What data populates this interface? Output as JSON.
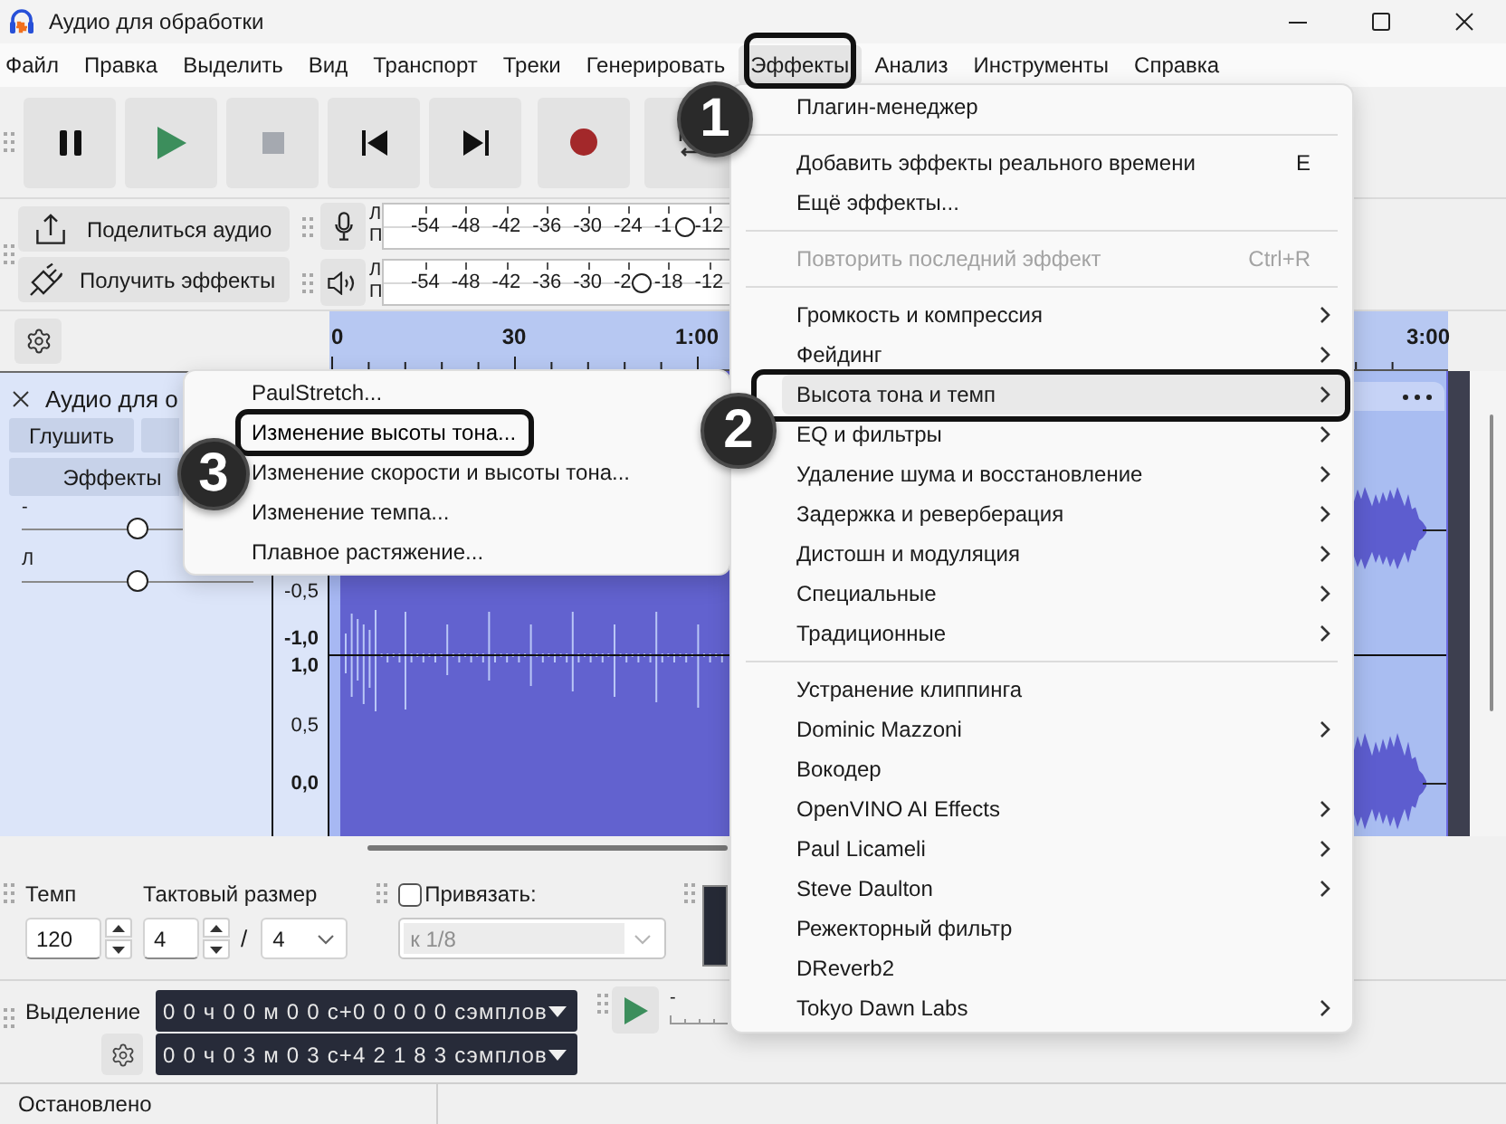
{
  "window": {
    "title": "Аудио для обработки"
  },
  "menu_bar": [
    {
      "label": "Файл",
      "selected": false
    },
    {
      "label": "Правка",
      "selected": false
    },
    {
      "label": "Выделить",
      "selected": false
    },
    {
      "label": "Вид",
      "selected": false
    },
    {
      "label": "Транспорт",
      "selected": false
    },
    {
      "label": "Треки",
      "selected": false
    },
    {
      "label": "Генерировать",
      "selected": false
    },
    {
      "label": "Эффекты",
      "selected": true
    },
    {
      "label": "Анализ",
      "selected": false
    },
    {
      "label": "Инструменты",
      "selected": false
    },
    {
      "label": "Справка",
      "selected": false
    }
  ],
  "share_buttons": [
    "Поделиться аудио",
    "Получить эффекты"
  ],
  "meters": [
    {
      "kind": "recording",
      "channels": [
        "Л",
        "П"
      ],
      "ticks": [
        "-54",
        "-48",
        "-42",
        "-36",
        "-30",
        "-24",
        "-1",
        "-12"
      ],
      "level": 0.84
    },
    {
      "kind": "playback",
      "channels": [
        "Л",
        "П"
      ],
      "ticks": [
        "-54",
        "-48",
        "-42",
        "-36",
        "-30",
        "-2",
        "-18",
        "-12"
      ],
      "level": 0.72
    }
  ],
  "ruler": {
    "labels": [
      "0",
      "30",
      "1:00",
      "3:00"
    ]
  },
  "track": {
    "name": "Аудио для о",
    "mute_button": "Глушить",
    "effects_button": "Эффекты",
    "sliders": [
      {
        "label": "-",
        "level": 0.5
      },
      {
        "label": "Л",
        "level": 0.5
      }
    ],
    "scale": [
      {
        "label": "-0,5",
        "kind": "minor"
      },
      {
        "label": "-1,0",
        "kind": "major"
      },
      {
        "label": "1,0",
        "kind": "major"
      },
      {
        "label": "0,5",
        "kind": "minor"
      },
      {
        "label": "0,0",
        "kind": "major"
      }
    ]
  },
  "time_toolbar": {
    "tempo": {
      "label": "Темп",
      "value": "120"
    },
    "time_signature": {
      "label": "Тактовый размер",
      "upper": "4",
      "separator": "/",
      "lower": "4"
    },
    "snap": {
      "label": "Привязать:",
      "checked": false,
      "value": "к 1/8",
      "disabled": true
    }
  },
  "selection_toolbar": {
    "label": "Выделение",
    "start": "0 0 ч 0 0 м 0 0 с+0 0 0 0 0 сэмплов",
    "end": "0 0 ч 0 3 м 0 3 с+4 2 1 8 3 сэмплов",
    "speed_label": "-"
  },
  "status_bar": {
    "text": "Остановлено"
  },
  "effects_menu": {
    "groups": [
      [
        {
          "label": "Плагин-менеджер",
          "submenu": false,
          "disabled": false,
          "selected": false
        }
      ],
      [
        {
          "label": "Добавить эффекты реального времени",
          "shortcut": "E",
          "submenu": false,
          "disabled": false,
          "selected": false
        },
        {
          "label": "Ещё эффекты...",
          "submenu": false,
          "disabled": false,
          "selected": false
        }
      ],
      [
        {
          "label": "Повторить последний эффект",
          "shortcut": "Ctrl+R",
          "submenu": false,
          "disabled": true,
          "selected": false
        }
      ],
      [
        {
          "label": "Громкость и компрессия",
          "submenu": true,
          "disabled": false,
          "selected": false
        },
        {
          "label": "Фейдинг",
          "submenu": true,
          "disabled": false,
          "selected": false
        },
        {
          "label": "Высота тона и темп",
          "submenu": true,
          "disabled": false,
          "selected": true
        },
        {
          "label": "EQ и фильтры",
          "submenu": true,
          "disabled": false,
          "selected": false
        },
        {
          "label": "Удаление шума и восстановление",
          "submenu": true,
          "disabled": false,
          "selected": false
        },
        {
          "label": "Задержка и реверберация",
          "submenu": true,
          "disabled": false,
          "selected": false
        },
        {
          "label": "Дистошн и модуляция",
          "submenu": true,
          "disabled": false,
          "selected": false
        },
        {
          "label": "Специальные",
          "submenu": true,
          "disabled": false,
          "selected": false
        },
        {
          "label": "Традиционные",
          "submenu": true,
          "disabled": false,
          "selected": false
        }
      ],
      [
        {
          "label": "Устранение клиппинга",
          "submenu": false,
          "disabled": false,
          "selected": false
        },
        {
          "label": "Dominic Mazzoni",
          "submenu": true,
          "disabled": false,
          "selected": false
        },
        {
          "label": "Вокодер",
          "submenu": false,
          "disabled": false,
          "selected": false
        },
        {
          "label": "OpenVINO AI Effects",
          "submenu": true,
          "disabled": false,
          "selected": false
        },
        {
          "label": "Paul Licameli",
          "submenu": true,
          "disabled": false,
          "selected": false
        },
        {
          "label": "Steve Daulton",
          "submenu": true,
          "disabled": false,
          "selected": false
        },
        {
          "label": "Режекторный фильтр",
          "submenu": false,
          "disabled": false,
          "selected": false
        },
        {
          "label": "DReverb2",
          "submenu": false,
          "disabled": false,
          "selected": false
        },
        {
          "label": "Tokyo Dawn Labs",
          "submenu": true,
          "disabled": false,
          "selected": false
        }
      ]
    ]
  },
  "pitch_submenu": {
    "items": [
      {
        "label": "PaulStretch...",
        "selected": false
      },
      {
        "label": "Изменение высоты тона...",
        "selected": true
      },
      {
        "label": "Изменение скорости и высоты тона...",
        "selected": false
      },
      {
        "label": "Изменение темпа...",
        "selected": false
      },
      {
        "label": "Плавное растяжение...",
        "selected": false
      }
    ]
  },
  "step_badges": [
    "1",
    "2",
    "3"
  ]
}
